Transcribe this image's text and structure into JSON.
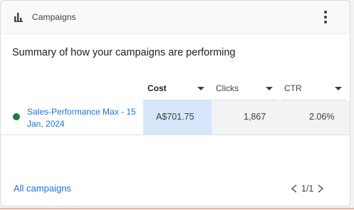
{
  "header": {
    "title": "Campaigns",
    "chart_icon": "bar-chart-icon",
    "more_icon": "more-vert-icon"
  },
  "summary_text": "Summary of how your campaigns are performing",
  "table": {
    "columns": [
      {
        "label": "Cost"
      },
      {
        "label": "Clicks"
      },
      {
        "label": "CTR"
      }
    ],
    "rows": [
      {
        "status_color": "#188038",
        "campaign": "Sales-Performance Max - 15 Jan, 2024",
        "cost": "A$701.75",
        "clicks": "1,867",
        "ctr": "2.06%"
      }
    ]
  },
  "footer": {
    "link": "All campaigns",
    "pagination": "1/1"
  },
  "colors": {
    "link": "#1a73e8",
    "highlight": "#d6e6fb",
    "status_active": "#188038"
  }
}
